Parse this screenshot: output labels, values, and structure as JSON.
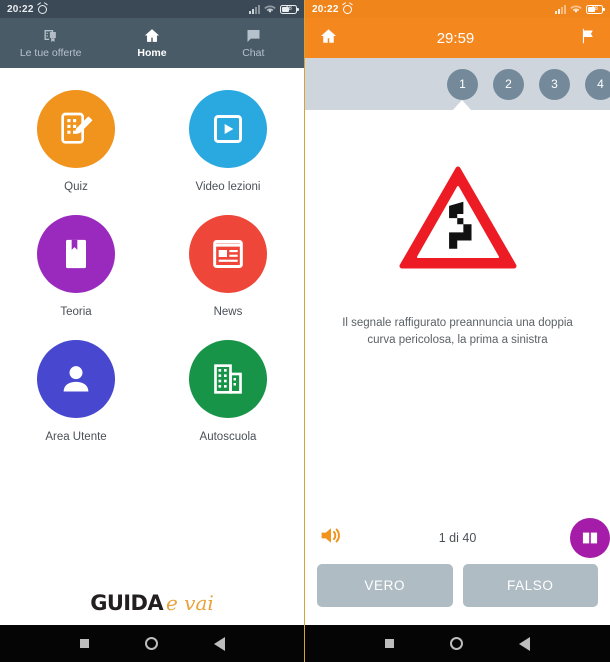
{
  "left_phone": {
    "statusbar": {
      "time": "20:22",
      "alarm_icon": "alarm-icon",
      "signal_icon": "signal-icon",
      "wifi_icon": "wifi-icon",
      "battery_icon": "battery-icon",
      "battery_level": "48"
    },
    "tabs": [
      {
        "label": "Le tue offerte",
        "icon": "certificate-icon",
        "active": false
      },
      {
        "label": "Home",
        "icon": "home-icon",
        "active": true
      },
      {
        "label": "Chat",
        "icon": "chat-bubble-icon",
        "active": false
      }
    ],
    "grid": [
      {
        "label": "Quiz",
        "icon": "quiz-form-pencil-icon",
        "color": "#f0941e"
      },
      {
        "label": "Video lezioni",
        "icon": "video-play-icon",
        "color": "#2aa9e0"
      },
      {
        "label": "Teoria",
        "icon": "book-bookmark-icon",
        "color": "#9a29bd"
      },
      {
        "label": "News",
        "icon": "newspaper-icon",
        "color": "#ee4639"
      },
      {
        "label": "Area Utente",
        "icon": "user-person-icon",
        "color": "#4747cf"
      },
      {
        "label": "Autoscuola",
        "icon": "building-icon",
        "color": "#179448"
      }
    ],
    "logo": {
      "part1": "GUIDA",
      "part2": "e vai"
    },
    "navbar": {
      "recents_icon": "square-recents-icon",
      "home_icon": "circle-home-icon",
      "back_icon": "triangle-back-icon"
    }
  },
  "right_phone": {
    "statusbar": {
      "time": "20:22",
      "alarm_icon": "alarm-icon",
      "signal_icon": "signal-icon",
      "wifi_icon": "wifi-icon",
      "battery_icon": "battery-icon",
      "battery_level": "48"
    },
    "header": {
      "home_icon": "home-icon",
      "timer": "29:59",
      "flag_icon": "flag-icon",
      "color": "#f5871f"
    },
    "question_nav": {
      "numbers": [
        "1",
        "2",
        "3",
        "4"
      ],
      "current": "1"
    },
    "sign": {
      "name": "double-curve-left-warning-sign",
      "shape": "triangle",
      "border_color": "#ed1c24"
    },
    "question_text": "Il segnale raffigurato preannuncia una doppia curva pericolosa, la prima a sinistra",
    "controls": {
      "speaker_icon": "speaker-volume-icon",
      "counter": "1 di 40",
      "book_icon": "open-book-icon",
      "answers": [
        {
          "label": "VERO"
        },
        {
          "label": "FALSO"
        }
      ]
    },
    "navbar": {
      "recents_icon": "square-recents-icon",
      "home_icon": "circle-home-icon",
      "back_icon": "triangle-back-icon"
    }
  }
}
